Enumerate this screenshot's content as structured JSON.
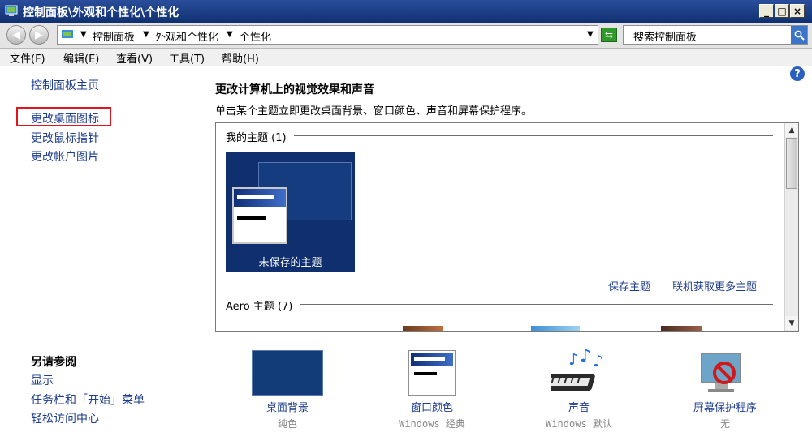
{
  "window": {
    "title": "控制面板\\外观和个性化\\个性化",
    "minimize": "_",
    "maximize": "□",
    "close": "×"
  },
  "address": {
    "crumb1": "控制面板",
    "crumb2": "外观和个性化",
    "crumb3": "个性化",
    "search_placeholder": "搜索控制面板"
  },
  "menu": {
    "file": "文件(F)",
    "edit": "编辑(E)",
    "view": "查看(V)",
    "tools": "工具(T)",
    "help": "帮助(H)"
  },
  "sidebar": {
    "home": "控制面板主页",
    "desktop_icons": "更改桌面图标",
    "mouse_pointers": "更改鼠标指针",
    "account_picture": "更改帐户图片",
    "see_also_heading": "另请参阅",
    "display": "显示",
    "taskbar": "任务栏和「开始」菜单",
    "ease_of_access": "轻松访问中心"
  },
  "main": {
    "title": "更改计算机上的视觉效果和声音",
    "description": "单击某个主题立即更改桌面背景、窗口颜色、声音和屏幕保护程序。",
    "my_themes_header": "我的主题 (1)",
    "unsaved_theme_label": "未保存的主题",
    "save_theme_link": "保存主题",
    "get_more_link": "联机获取更多主题",
    "aero_header": "Aero 主题 (7)"
  },
  "bottom": {
    "bg_label": "桌面背景",
    "bg_sub": "纯色",
    "color_label": "窗口颜色",
    "color_sub": "Windows 经典",
    "sound_label": "声音",
    "sound_sub": "Windows 默认",
    "saver_label": "屏幕保护程序",
    "saver_sub": "无"
  },
  "colors": {
    "titlebar": "#1c3f8a",
    "link": "#1e3d8f",
    "theme_tile": "#0f2f6e",
    "highlight_border": "#e0141e",
    "swatch": "#123c78"
  },
  "icons": [
    "control-panel-icon",
    "back-arrow-icon",
    "forward-arrow-icon",
    "refresh-icon",
    "search-icon",
    "help-icon",
    "sound-icon",
    "screensaver-icon"
  ]
}
